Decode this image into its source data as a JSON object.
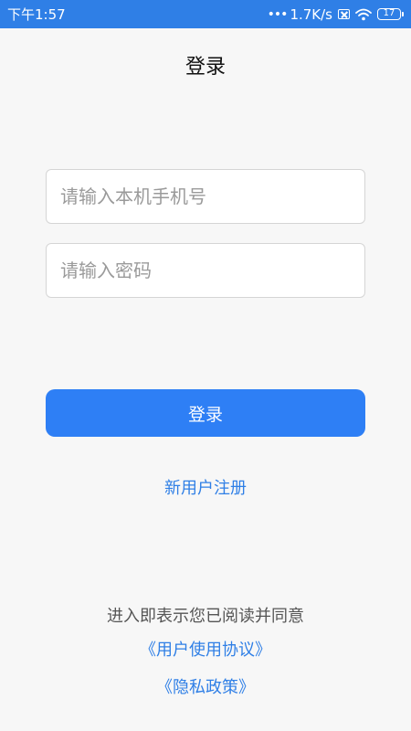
{
  "status_bar": {
    "time": "下午1:57",
    "network_speed": "1.7K/s",
    "battery_level": "17",
    "background_color": "#2f7fe6",
    "icons": [
      "signal-dots-icon",
      "sim-card-icon",
      "wifi-icon",
      "battery-icon"
    ]
  },
  "header": {
    "title": "登录"
  },
  "form": {
    "phone_placeholder": "请输入本机手机号",
    "phone_value": "",
    "password_placeholder": "请输入密码",
    "password_value": "",
    "login_label": "登录",
    "button_color": "#2e7ff5"
  },
  "register": {
    "label": "新用户注册"
  },
  "footer": {
    "agree_text": "进入即表示您已阅读并同意",
    "user_agreement": "《用户使用协议》",
    "privacy_policy": "《隐私政策》",
    "link_color": "#2f7fe6"
  }
}
